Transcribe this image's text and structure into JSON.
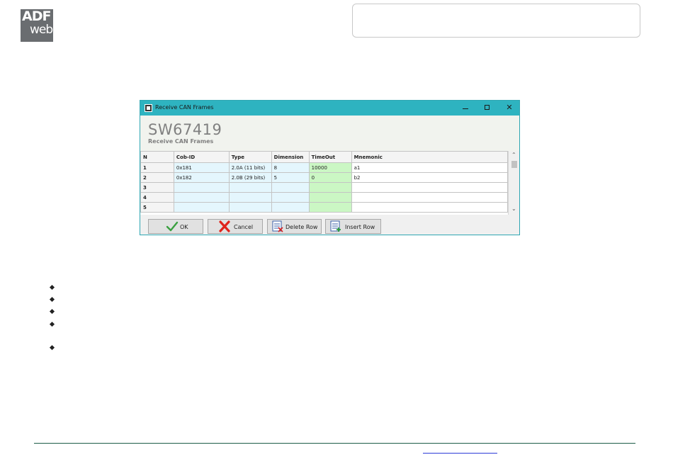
{
  "logo": {
    "line1": "ADF",
    "line2": "web"
  },
  "window": {
    "title": "Receive CAN Frames",
    "close_glyph": "✕"
  },
  "heading": {
    "product_code": "SW67419",
    "subtitle": "Receive CAN Frames"
  },
  "grid": {
    "columns": [
      "N",
      "Cob-ID",
      "Type",
      "Dimension",
      "TimeOut",
      "Mnemonic"
    ],
    "rows": [
      [
        "1",
        "0x181",
        "2.0A (11 bits)",
        "8",
        "10000",
        "a1"
      ],
      [
        "2",
        "0x182",
        "2.0B (29 bits)",
        "5",
        "0",
        "b2"
      ],
      [
        "3",
        "",
        "",
        "",
        "",
        ""
      ],
      [
        "4",
        "",
        "",
        "",
        "",
        ""
      ],
      [
        "5",
        "",
        "",
        "",
        "",
        ""
      ]
    ]
  },
  "scrollbar": {
    "up_glyph": "⌃",
    "down_glyph": "⌄"
  },
  "buttons": {
    "ok": "OK",
    "cancel": "Cancel",
    "delete_row": "Delete Row",
    "insert_row": "Insert Row"
  },
  "icons": {
    "ok": "checkmark-icon",
    "cancel": "red-x-icon",
    "delete_row": "delete-row-icon",
    "insert_row": "insert-row-icon"
  },
  "colors": {
    "titlebar": "#2eb3c0",
    "cell_blue": "#e4f6fd",
    "cell_green": "#cbf7c4",
    "logo_bg": "#6a6d70"
  }
}
